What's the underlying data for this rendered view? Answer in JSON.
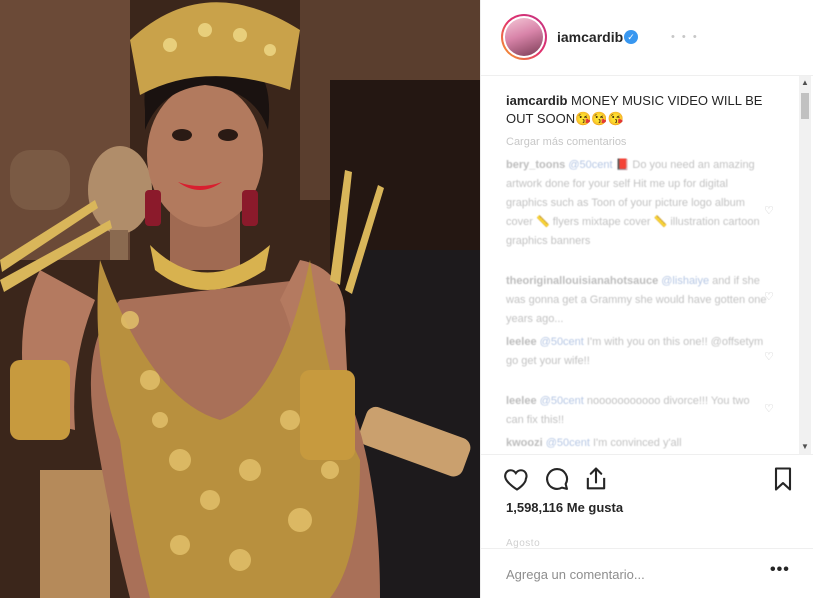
{
  "post": {
    "username": "iamcardib",
    "verified_icon": "verified-badge-icon",
    "header_meta": "• • •",
    "caption_user": "iamcardib",
    "caption_text": " MONEY MUSIC VIDEO WILL BE OUT SOON😘😘😘",
    "load_more": "Cargar más comentarios",
    "likes_count": "1,598,116",
    "likes_label": "Me gusta",
    "time_ago": "Agosto",
    "add_comment_placeholder": "Agrega un comentario...",
    "more_options": "•••"
  },
  "comments": [
    {
      "user": "bery_toons",
      "mention": "@50cent",
      "text": " 📕 Do you need an amazing artwork done for your self Hit me up for digital graphics such as Toon of your picture logo album cover 📏 flyers mixtape cover 📏 illustration cartoon graphics banners"
    },
    {
      "user": "theoriginallouisianahotsauce",
      "mention": "@lishaiye",
      "text": " and if she was gonna get a Grammy she would have gotten one years ago..."
    },
    {
      "user": "leelee",
      "mention": "@50cent",
      "text": " I'm with you on this one!! @offsetym go get your wife!!"
    },
    {
      "user": "leelee",
      "mention": "@50cent",
      "text": " nooooooooooo divorce!!! You two can fix this!!"
    },
    {
      "user": "kwoozi",
      "mention": "@50cent",
      "text": " I'm convinced y'all"
    }
  ],
  "icons": {
    "like": "heart-icon",
    "comment": "speech-bubble-icon",
    "share": "share-icon",
    "save": "bookmark-icon",
    "comment_like": "small-heart-icon"
  },
  "colors": {
    "verified": "#3897f0",
    "text": "#262626",
    "muted": "#8e8e8e"
  }
}
